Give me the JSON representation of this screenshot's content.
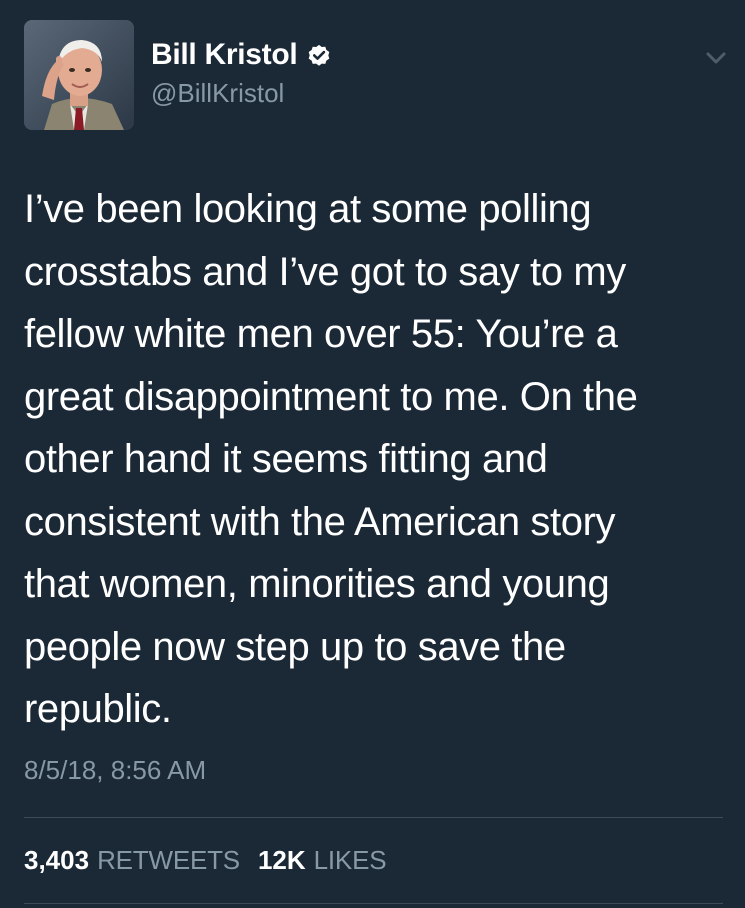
{
  "author": {
    "display_name": "Bill Kristol",
    "handle": "@BillKristol",
    "verified": true,
    "avatar_icon": "profile-photo",
    "verified_icon": "verified-badge-icon"
  },
  "menu": {
    "icon": "chevron-down-icon"
  },
  "tweet": {
    "text": "I’ve been looking at some polling\ncrosstabs and I’ve got to say to my\nfellow white men over 55: You’re a\ngreat disappointment to me. On the\nother hand it seems fitting and\nconsistent with the American story\nthat women, minorities and young\npeople now step up to save the\nrepublic.",
    "timestamp": "8/5/18, 8:56 AM"
  },
  "stats": {
    "retweets_count": "3,403",
    "retweets_label": "RETWEETS",
    "likes_count": "12K",
    "likes_label": "LIKES"
  },
  "colors": {
    "background": "#1b2836",
    "text_primary": "#ffffff",
    "text_secondary": "#8899a6",
    "divider": "#3d4a58"
  }
}
